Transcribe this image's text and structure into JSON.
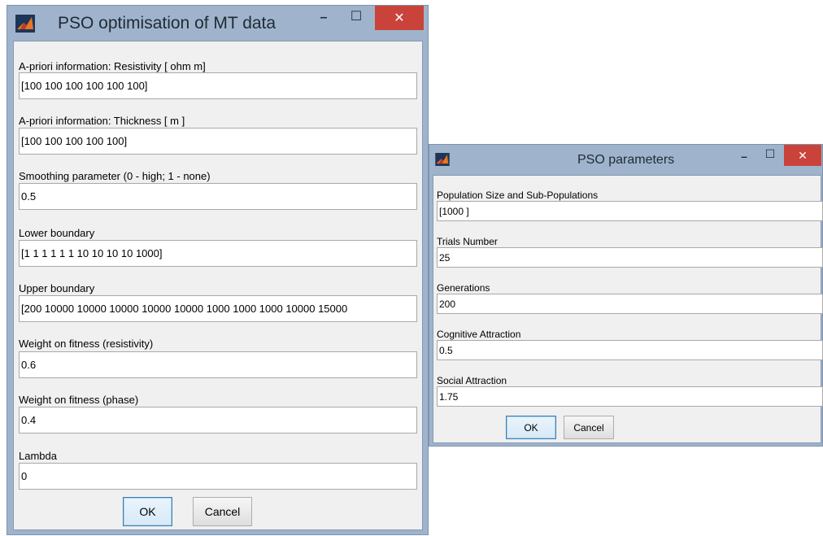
{
  "colors": {
    "frame": "#9fb4cc",
    "client": "#f0f0f0",
    "close_button": "#c9433a",
    "input_bg": "#ffffff"
  },
  "main_window": {
    "title": "PSO optimisation of MT data",
    "icon": "matlab-icon",
    "controls": {
      "minimize": "–",
      "maximize": "☐",
      "close": "✕"
    },
    "fields": [
      {
        "label": "A-priori information: Resistivity [ ohm m]",
        "value": "[100 100 100 100 100 100]"
      },
      {
        "label": "A-priori information: Thickness [ m ]",
        "value": "[100 100 100 100 100]"
      },
      {
        "label": "Smoothing parameter (0 - high; 1 - none)",
        "value": "0.5"
      },
      {
        "label": "Lower boundary",
        "value": "[1 1 1 1 1 1 10 10 10 10 1000]"
      },
      {
        "label": "Upper boundary",
        "value": "[200 10000 10000 10000 10000 10000 1000 1000 1000 10000 15000"
      },
      {
        "label": "Weight on fitness (resistivity)",
        "value": "0.6"
      },
      {
        "label": "Weight on fitness (phase)",
        "value": "0.4"
      },
      {
        "label": "Lambda",
        "value": "0"
      }
    ],
    "ok_label": "OK",
    "cancel_label": "Cancel"
  },
  "pso_window": {
    "title": "PSO parameters",
    "icon": "matlab-icon",
    "controls": {
      "minimize": "–",
      "maximize": "☐",
      "close": "✕"
    },
    "fields": [
      {
        "label": "Population Size and Sub-Populations",
        "value": "[1000 ]"
      },
      {
        "label": "Trials Number",
        "value": "25"
      },
      {
        "label": "Generations",
        "value": "200"
      },
      {
        "label": "Cognitive Attraction",
        "value": "0.5"
      },
      {
        "label": "Social Attraction",
        "value": "1.75"
      }
    ],
    "ok_label": "OK",
    "cancel_label": "Cancel"
  }
}
